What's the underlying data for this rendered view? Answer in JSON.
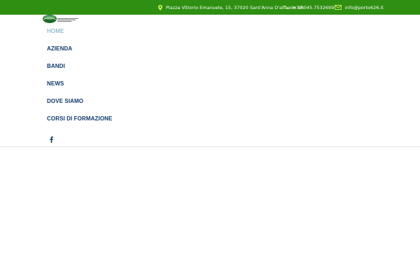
{
  "topbar": {
    "address": "Piazza Vittorio Emanuele, 15, 37020 Sant'Anna D'alfaedo VR",
    "phone": "+39.045.7532699",
    "email": "info@porto626.it",
    "color": "#2f8f12"
  },
  "nav": {
    "items": [
      {
        "label": "HOME",
        "active": true
      },
      {
        "label": "AZIENDA"
      },
      {
        "label": "BANDI"
      },
      {
        "label": "NEWS"
      },
      {
        "label": "DOVE SIAMO"
      },
      {
        "label": "CORSI DI FORMAZIONE"
      }
    ]
  },
  "social": {
    "facebook_icon": "facebook-icon"
  }
}
